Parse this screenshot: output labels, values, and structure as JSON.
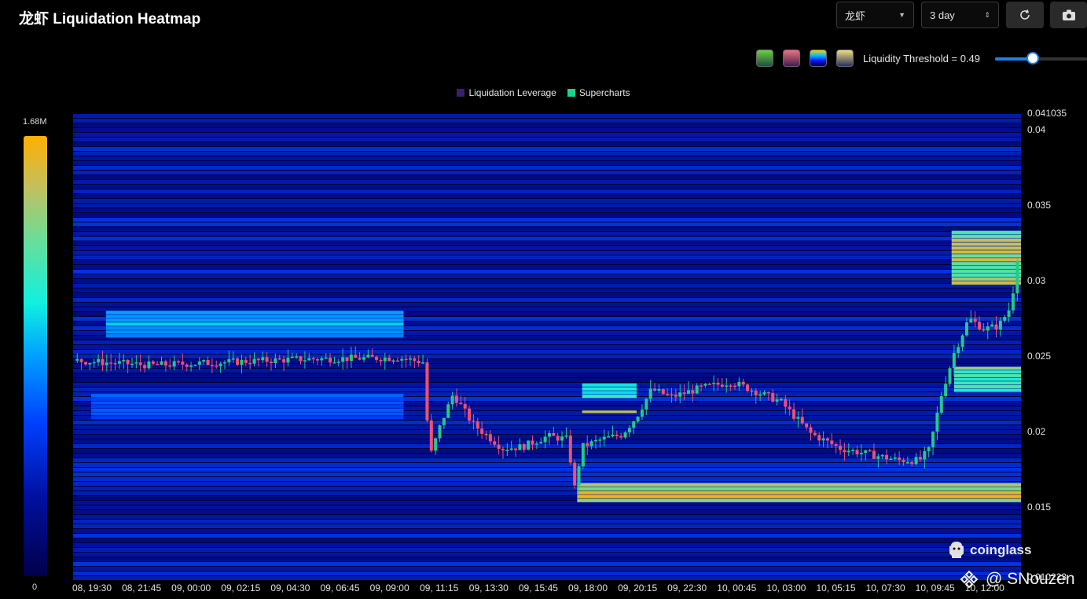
{
  "header": {
    "title": "龙虾 Liquidation Heatmap",
    "symbol_select": "龙虾",
    "range_select": "3 day",
    "refresh_icon": "refresh-icon",
    "camera_icon": "camera-icon"
  },
  "controls": {
    "palettes": [
      "#3aa04a",
      "#e04060",
      "#1040ff",
      "#2040a0"
    ],
    "threshold_label": "Liquidity Threshold = 0.49",
    "threshold_value": 0.49
  },
  "colors": {
    "background": "#000000",
    "heat_low": "#00004a",
    "heat_high": "#ffb000",
    "candle_up": "#26c88a",
    "candle_down": "#f0506e",
    "accent": "#1f7fe6"
  },
  "chart_data": {
    "type": "heatmap",
    "legend": [
      {
        "name": "Liquidation Leverage",
        "color": "#3a1e6e"
      },
      {
        "name": "Supercharts",
        "color": "#1fd18a"
      }
    ],
    "colorbar": {
      "min_label": "0",
      "max_label": "1.68M",
      "max": 1680000
    },
    "y_axis": {
      "ticks": [
        "0.041035",
        "0.04",
        "0.035",
        "0.03",
        "0.025",
        "0.02",
        "0.015",
        "0.010223"
      ],
      "range": [
        0.010223,
        0.041035
      ]
    },
    "x_axis": {
      "ticks": [
        "08, 19:30",
        "08, 21:45",
        "09, 00:00",
        "09, 02:15",
        "09, 04:30",
        "09, 06:45",
        "09, 09:00",
        "09, 11:15",
        "09, 13:30",
        "09, 15:45",
        "09, 18:00",
        "09, 20:15",
        "09, 22:30",
        "10, 00:45",
        "10, 03:00",
        "10, 05:15",
        "10, 07:30",
        "10, 09:45",
        "10, 12:00"
      ]
    },
    "price_path": [
      {
        "t": 0,
        "p": 0.0247
      },
      {
        "t": 1.5,
        "p": 0.0244
      },
      {
        "t": 3,
        "p": 0.0246
      },
      {
        "t": 4.5,
        "p": 0.0248
      },
      {
        "t": 6.5,
        "p": 0.0249
      },
      {
        "t": 7.0,
        "p": 0.0246
      },
      {
        "t": 7.05,
        "p": 0.0215
      },
      {
        "t": 7.15,
        "p": 0.0185
      },
      {
        "t": 7.35,
        "p": 0.0205
      },
      {
        "t": 7.6,
        "p": 0.0225
      },
      {
        "t": 8.0,
        "p": 0.0205
      },
      {
        "t": 8.6,
        "p": 0.0189
      },
      {
        "t": 9.0,
        "p": 0.019
      },
      {
        "t": 9.5,
        "p": 0.0197
      },
      {
        "t": 9.9,
        "p": 0.0195
      },
      {
        "t": 10.05,
        "p": 0.0163
      },
      {
        "t": 10.2,
        "p": 0.019
      },
      {
        "t": 10.6,
        "p": 0.0195
      },
      {
        "t": 11.0,
        "p": 0.0198
      },
      {
        "t": 11.3,
        "p": 0.021
      },
      {
        "t": 11.6,
        "p": 0.0228
      },
      {
        "t": 12.0,
        "p": 0.0223
      },
      {
        "t": 12.6,
        "p": 0.0229
      },
      {
        "t": 13.2,
        "p": 0.0233
      },
      {
        "t": 13.6,
        "p": 0.0228
      },
      {
        "t": 14.2,
        "p": 0.022
      },
      {
        "t": 14.8,
        "p": 0.0199
      },
      {
        "t": 15.4,
        "p": 0.0189
      },
      {
        "t": 16.0,
        "p": 0.0185
      },
      {
        "t": 16.6,
        "p": 0.0181
      },
      {
        "t": 17.0,
        "p": 0.0181
      },
      {
        "t": 17.2,
        "p": 0.0188
      },
      {
        "t": 17.45,
        "p": 0.0225
      },
      {
        "t": 17.7,
        "p": 0.0252
      },
      {
        "t": 18.0,
        "p": 0.0275
      },
      {
        "t": 18.3,
        "p": 0.0268
      },
      {
        "t": 18.6,
        "p": 0.027
      },
      {
        "t": 18.85,
        "p": 0.0283
      },
      {
        "t": 19.0,
        "p": 0.0322
      }
    ],
    "hot_zones": [
      {
        "price_low": 0.0153,
        "price_high": 0.0166,
        "t_start": 10.1,
        "t_end": 19.2,
        "level": 1.0
      },
      {
        "price_low": 0.0297,
        "price_high": 0.0333,
        "t_start": 17.65,
        "t_end": 19.2,
        "level": 0.95
      },
      {
        "price_low": 0.0226,
        "price_high": 0.0243,
        "t_start": 17.7,
        "t_end": 19.2,
        "level": 0.85
      },
      {
        "price_low": 0.0262,
        "price_high": 0.028,
        "t_start": 0.6,
        "t_end": 6.6,
        "level": 0.6
      },
      {
        "price_low": 0.0208,
        "price_high": 0.0225,
        "t_start": 0.3,
        "t_end": 6.6,
        "level": 0.45
      },
      {
        "price_low": 0.0212,
        "price_high": 0.0214,
        "t_start": 10.2,
        "t_end": 11.3,
        "level": 0.95
      },
      {
        "price_low": 0.0222,
        "price_high": 0.0232,
        "t_start": 10.2,
        "t_end": 11.3,
        "level": 0.7
      }
    ]
  },
  "branding": {
    "logo_text": "coinglass",
    "watermark": "@ SNouzen"
  }
}
